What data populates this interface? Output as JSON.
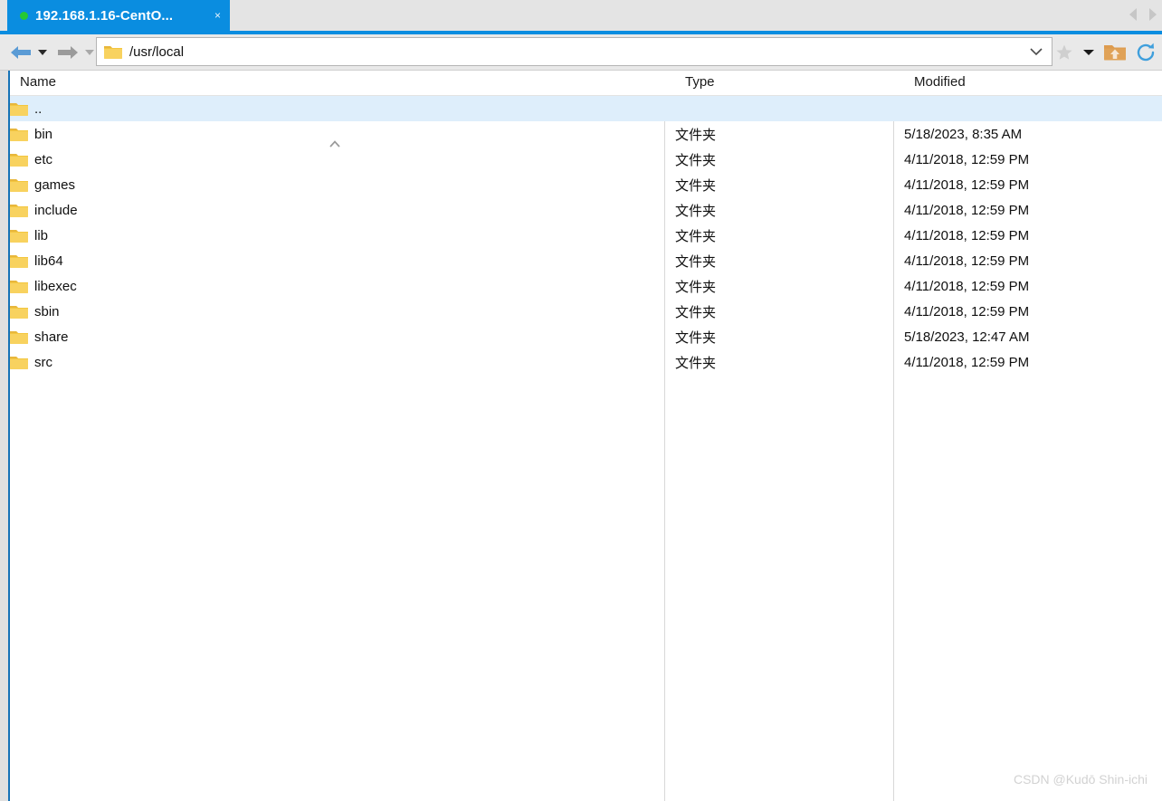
{
  "tabstrip": {
    "tab": {
      "title": "192.168.1.16-CentO...",
      "status_dot_color": "#25c935",
      "close_label": "×",
      "background": "#0a8de0"
    },
    "nav_prev_label": "scroll-tabs-left",
    "nav_next_label": "scroll-tabs-right"
  },
  "toolbar": {
    "back_label": "Back",
    "back_dropdown_label": "Back history",
    "forward_label": "Forward",
    "forward_dropdown_label": "Forward history",
    "address": {
      "value": "/usr/local",
      "placeholder": "Enter path",
      "icon": "folder-icon",
      "dropdown_icon": "chevron-down-icon"
    },
    "bookmark_label": "Bookmark",
    "bookmark_dropdown_label": "Bookmark menu",
    "parent_folder_label": "Open parent directory",
    "refresh_label": "Refresh"
  },
  "filelist": {
    "columns": [
      "Name",
      "Type",
      "Modified"
    ],
    "sort": {
      "column": "Name",
      "direction": "ascending",
      "indicator": "caret-up"
    },
    "rows": [
      {
        "name": "..",
        "type": "",
        "modified": "",
        "selected": true,
        "icon": "folder-icon"
      },
      {
        "name": "bin",
        "type": "文件夹",
        "modified": "5/18/2023, 8:35 AM",
        "selected": false,
        "icon": "folder-icon"
      },
      {
        "name": "etc",
        "type": "文件夹",
        "modified": "4/11/2018, 12:59 PM",
        "selected": false,
        "icon": "folder-icon"
      },
      {
        "name": "games",
        "type": "文件夹",
        "modified": "4/11/2018, 12:59 PM",
        "selected": false,
        "icon": "folder-icon"
      },
      {
        "name": "include",
        "type": "文件夹",
        "modified": "4/11/2018, 12:59 PM",
        "selected": false,
        "icon": "folder-icon"
      },
      {
        "name": "lib",
        "type": "文件夹",
        "modified": "4/11/2018, 12:59 PM",
        "selected": false,
        "icon": "folder-icon"
      },
      {
        "name": "lib64",
        "type": "文件夹",
        "modified": "4/11/2018, 12:59 PM",
        "selected": false,
        "icon": "folder-icon"
      },
      {
        "name": "libexec",
        "type": "文件夹",
        "modified": "4/11/2018, 12:59 PM",
        "selected": false,
        "icon": "folder-icon"
      },
      {
        "name": "sbin",
        "type": "文件夹",
        "modified": "4/11/2018, 12:59 PM",
        "selected": false,
        "icon": "folder-icon"
      },
      {
        "name": "share",
        "type": "文件夹",
        "modified": "5/18/2023, 12:47 AM",
        "selected": false,
        "icon": "folder-icon"
      },
      {
        "name": "src",
        "type": "文件夹",
        "modified": "4/11/2018, 12:59 PM",
        "selected": false,
        "icon": "folder-icon"
      }
    ]
  },
  "watermark": {
    "text": "CSDN @Kudō Shin-ichi"
  },
  "colors": {
    "accent": "#0a8de0",
    "selection": "#deeefb",
    "folder": "#f6c855",
    "folder_dark": "#e8b73c",
    "toolbar_bg": "#e9e9e9",
    "tabstrip_bg": "#e4e4e4",
    "focus_border": "#1572b6"
  }
}
